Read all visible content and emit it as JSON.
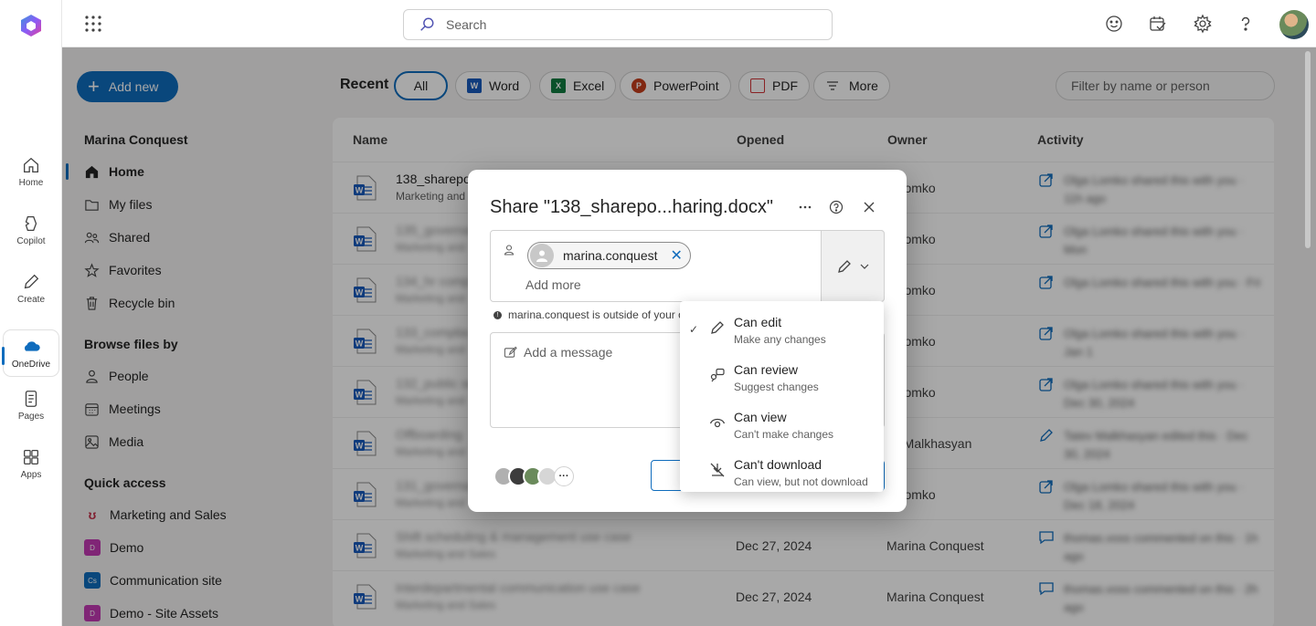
{
  "rail": {
    "items": [
      {
        "label": "Home"
      },
      {
        "label": "Copilot"
      },
      {
        "label": "Create"
      },
      {
        "label": "OneDrive"
      },
      {
        "label": "Pages"
      },
      {
        "label": "Apps"
      }
    ]
  },
  "topbar": {
    "search_placeholder": "Search"
  },
  "sidebar": {
    "add_new_label": "Add new",
    "user_name": "Marina Conquest",
    "nav_items": [
      {
        "label": "Home",
        "icon": "home-icon"
      },
      {
        "label": "My files",
        "icon": "folder-icon"
      },
      {
        "label": "Shared",
        "icon": "people-icon"
      },
      {
        "label": "Favorites",
        "icon": "star-icon"
      },
      {
        "label": "Recycle bin",
        "icon": "trash-icon"
      }
    ],
    "browse_heading": "Browse files by",
    "browse_items": [
      {
        "label": "People",
        "icon": "person-icon"
      },
      {
        "label": "Meetings",
        "icon": "calendar-icon"
      },
      {
        "label": "Media",
        "icon": "image-icon"
      }
    ],
    "quick_heading": "Quick access",
    "quick_items": [
      {
        "label": "Marketing and Sales",
        "color": "#c4314b",
        "abbr": ""
      },
      {
        "label": "Demo",
        "color": "#c239b3",
        "abbr": "D"
      },
      {
        "label": "Communication site",
        "color": "#0f6cbd",
        "abbr": "Cs"
      },
      {
        "label": "Demo - Site Assets",
        "color": "#c239b3",
        "abbr": "D"
      }
    ]
  },
  "filters": {
    "recent_label": "Recent",
    "pills": [
      {
        "label": "All"
      },
      {
        "label": "Word",
        "color": "#185abd",
        "abbr": "W"
      },
      {
        "label": "Excel",
        "color": "#107c41",
        "abbr": "X"
      },
      {
        "label": "PowerPoint",
        "color": "#c43e1c",
        "abbr": "P"
      },
      {
        "label": "PDF",
        "color": "#d13438",
        "abbr": ""
      },
      {
        "label": "More"
      }
    ],
    "filter_placeholder": "Filter by name or person"
  },
  "table": {
    "headers": {
      "name": "Name",
      "opened": "Opened",
      "owner": "Owner",
      "activity": "Activity"
    },
    "rows": [
      {
        "name": "138_sharepo",
        "location": "Marketing and",
        "opened": "",
        "owner": "a Lomko",
        "activity": "Olga Lomko shared this with you · 11h ago"
      },
      {
        "name": "135_governa",
        "location": "Marketing and",
        "opened": "",
        "owner": "a Lomko",
        "activity": "Olga Lomko shared this with you · Mon"
      },
      {
        "name": "134_hr comp",
        "location": "Marketing and",
        "opened": "",
        "owner": "a Lomko",
        "activity": "Olga Lomko shared this with you · Fri"
      },
      {
        "name": "133_complia",
        "location": "Marketing and",
        "opened": "",
        "owner": "a Lomko",
        "activity": "Olga Lomko shared this with you · Jan 1"
      },
      {
        "name": "132_public se",
        "location": "Marketing and",
        "opened": "",
        "owner": "a Lomko",
        "activity": "Olga Lomko shared this with you · Dec 30, 2024"
      },
      {
        "name": "Offboarding",
        "location": "Marketing and",
        "opened": "",
        "owner": "ev Malkhasyan",
        "activity": "Tatev Malkhasyan edited this · Dec 30, 2024"
      },
      {
        "name": "131_governa",
        "location": "Marketing and",
        "opened": "",
        "owner": "a Lomko",
        "activity": "Olga Lomko shared this with you · Dec 18, 2024"
      },
      {
        "name": "Shift scheduling & management use case",
        "location": "Marketing and Sales",
        "opened": "Dec 27, 2024",
        "owner": "Marina Conquest",
        "activity": "thomas.voss commented on this · 1h ago"
      },
      {
        "name": "Interdepartmental communication use case",
        "location": "Marketing and Sales",
        "opened": "Dec 27, 2024",
        "owner": "Marina Conquest",
        "activity": "thomas.voss commented on this · 2h ago"
      }
    ]
  },
  "dialog": {
    "title": "Share \"138_sharepo...haring.docx\"",
    "recipient": "marina.conquest",
    "add_more": "Add more",
    "warning": "marina.conquest is outside of your o",
    "message_placeholder": "Add a message"
  },
  "permission_menu": {
    "items": [
      {
        "title": "Can edit",
        "subtitle": "Make any changes",
        "checked": true,
        "icon": "pencil-icon"
      },
      {
        "title": "Can review",
        "subtitle": "Suggest changes",
        "checked": false,
        "icon": "review-icon"
      },
      {
        "title": "Can view",
        "subtitle": "Can't make changes",
        "checked": false,
        "icon": "eye-icon"
      },
      {
        "title": "Can't download",
        "subtitle": "Can view, but not download",
        "checked": false,
        "icon": "no-download-icon"
      }
    ]
  },
  "colors": {
    "accent": "#0f6cbd"
  }
}
